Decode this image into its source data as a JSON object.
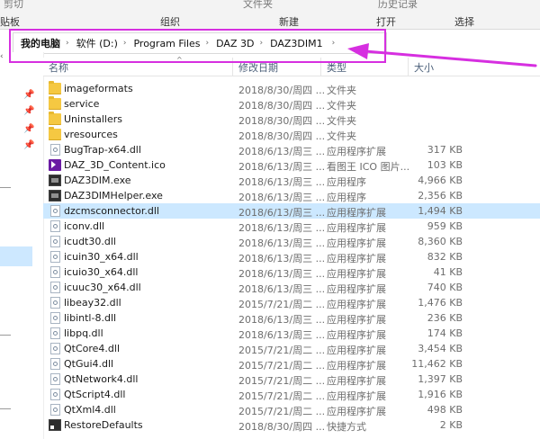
{
  "ribbon": {
    "top_left": "剪切",
    "top_mid": "文件夹",
    "top_right": "历史记录",
    "clipboard": "贴板",
    "organize": "组织",
    "new": "新建",
    "open": "打开",
    "select": "选择"
  },
  "address": {
    "crumbs": [
      "我的电脑",
      "软件 (D:)",
      "Program Files",
      "DAZ 3D",
      "DAZ3DIM1"
    ]
  },
  "columns": {
    "name": "名称",
    "date": "修改日期",
    "type": "类型",
    "size": "大小"
  },
  "accent": "#d62fe0",
  "files": [
    {
      "icon": "folder-icon",
      "name": "imageformats",
      "date": "2018/8/30/周四 ...",
      "type": "文件夹",
      "size": ""
    },
    {
      "icon": "folder-icon",
      "name": "service",
      "date": "2018/8/30/周四 ...",
      "type": "文件夹",
      "size": ""
    },
    {
      "icon": "folder-icon",
      "name": "Uninstallers",
      "date": "2018/8/30/周四 ...",
      "type": "文件夹",
      "size": ""
    },
    {
      "icon": "folder-icon",
      "name": "vresources",
      "date": "2018/8/30/周四 ...",
      "type": "文件夹",
      "size": ""
    },
    {
      "icon": "dll-icon",
      "name": "BugTrap-x64.dll",
      "date": "2018/6/13/周三 ...",
      "type": "应用程序扩展",
      "size": "317 KB"
    },
    {
      "icon": "daz-icon",
      "name": "DAZ_3D_Content.ico",
      "date": "2018/6/13/周三 ...",
      "type": "看图王 ICO 图片...",
      "size": "103 KB"
    },
    {
      "icon": "exe-icon",
      "name": "DAZ3DIM.exe",
      "date": "2018/6/13/周三 ...",
      "type": "应用程序",
      "size": "4,966 KB"
    },
    {
      "icon": "exe-icon",
      "name": "DAZ3DIMHelper.exe",
      "date": "2018/6/13/周三 ...",
      "type": "应用程序",
      "size": "2,356 KB"
    },
    {
      "icon": "dll-icon",
      "name": "dzcmsconnector.dll",
      "date": "2018/6/13/周三 ...",
      "type": "应用程序扩展",
      "size": "1,494 KB",
      "selected": true
    },
    {
      "icon": "dll-icon",
      "name": "iconv.dll",
      "date": "2018/6/13/周三 ...",
      "type": "应用程序扩展",
      "size": "959 KB"
    },
    {
      "icon": "dll-icon",
      "name": "icudt30.dll",
      "date": "2018/6/13/周三 ...",
      "type": "应用程序扩展",
      "size": "8,360 KB"
    },
    {
      "icon": "dll-icon",
      "name": "icuin30_x64.dll",
      "date": "2018/6/13/周三 ...",
      "type": "应用程序扩展",
      "size": "832 KB"
    },
    {
      "icon": "dll-icon",
      "name": "icuio30_x64.dll",
      "date": "2018/6/13/周三 ...",
      "type": "应用程序扩展",
      "size": "41 KB"
    },
    {
      "icon": "dll-icon",
      "name": "icuuc30_x64.dll",
      "date": "2018/6/13/周三 ...",
      "type": "应用程序扩展",
      "size": "740 KB"
    },
    {
      "icon": "dll-icon",
      "name": "libeay32.dll",
      "date": "2015/7/21/周二 ...",
      "type": "应用程序扩展",
      "size": "1,476 KB"
    },
    {
      "icon": "dll-icon",
      "name": "libintl-8.dll",
      "date": "2018/6/13/周三 ...",
      "type": "应用程序扩展",
      "size": "236 KB"
    },
    {
      "icon": "dll-icon",
      "name": "libpq.dll",
      "date": "2018/6/13/周三 ...",
      "type": "应用程序扩展",
      "size": "174 KB"
    },
    {
      "icon": "dll-icon",
      "name": "QtCore4.dll",
      "date": "2015/7/21/周二 ...",
      "type": "应用程序扩展",
      "size": "3,454 KB"
    },
    {
      "icon": "dll-icon",
      "name": "QtGui4.dll",
      "date": "2015/7/21/周二 ...",
      "type": "应用程序扩展",
      "size": "11,462 KB"
    },
    {
      "icon": "dll-icon",
      "name": "QtNetwork4.dll",
      "date": "2015/7/21/周二 ...",
      "type": "应用程序扩展",
      "size": "1,397 KB"
    },
    {
      "icon": "dll-icon",
      "name": "QtScript4.dll",
      "date": "2015/7/21/周二 ...",
      "type": "应用程序扩展",
      "size": "1,916 KB"
    },
    {
      "icon": "dll-icon",
      "name": "QtXml4.dll",
      "date": "2015/7/21/周二 ...",
      "type": "应用程序扩展",
      "size": "498 KB"
    },
    {
      "icon": "shortcut-icon",
      "name": "RestoreDefaults",
      "date": "2018/8/30/周四 ...",
      "type": "快捷方式",
      "size": "2 KB"
    }
  ]
}
